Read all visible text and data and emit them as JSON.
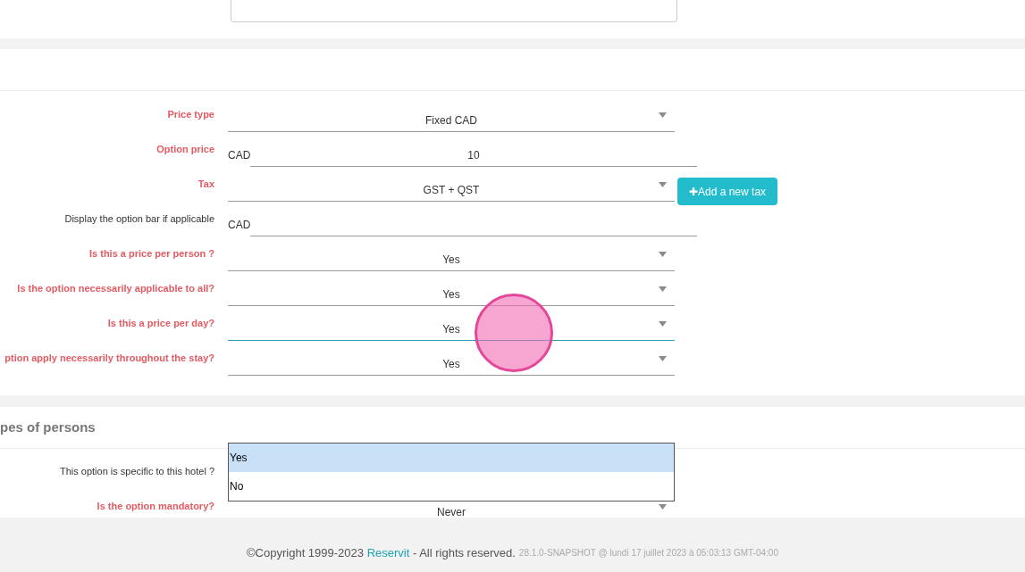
{
  "top_field": {
    "kind": "textarea"
  },
  "pricing_section": {
    "rows": [
      {
        "label": "Price type",
        "required": true,
        "kind": "select",
        "value": "Fixed CAD",
        "focused": false
      },
      {
        "label": "Option price",
        "required": true,
        "kind": "input",
        "prefix": "CAD",
        "value": "10",
        "focused": false
      },
      {
        "label": "Tax",
        "required": true,
        "kind": "select",
        "value": "GST + QST",
        "focused": false,
        "button": "✚Add a new tax"
      },
      {
        "label": "Display the option bar if applicable",
        "required": false,
        "kind": "input",
        "prefix": "CAD",
        "focused": false
      },
      {
        "label": "Is this a price per person ?",
        "required": true,
        "kind": "select",
        "value": "Yes",
        "focused": false
      },
      {
        "label": "Is the option necessarily applicable to all?",
        "required": true,
        "kind": "select",
        "value": "Yes",
        "focused": false
      },
      {
        "label": "Is this a price per day?",
        "required": true,
        "kind": "select",
        "value": "Yes",
        "focused": true
      },
      {
        "label": "ption apply necessarily throughout the stay?",
        "required": true,
        "kind": "select",
        "value": "Yes",
        "focused": false
      }
    ]
  },
  "persons_section": {
    "title": "pes of persons",
    "rows": [
      {
        "label": "This option is specific to this hotel ?",
        "required": false,
        "kind": "select",
        "open_options": [
          {
            "label": "Yes",
            "selected": true
          },
          {
            "label": "No",
            "selected": false
          }
        ]
      },
      {
        "label": "Is the option mandatory?",
        "required": true,
        "kind": "select",
        "value": "Never"
      }
    ]
  },
  "cursor_highlight": {
    "shown": true
  },
  "footer": {
    "copyright": "©Copyright 1999-2023 ",
    "link": "Reservit",
    "rights": " - All rights reserved.",
    "version": "28.1.0-SNAPSHOT @ lundi 17 juillet 2023 à 05:03:13 GMT-04:00"
  }
}
